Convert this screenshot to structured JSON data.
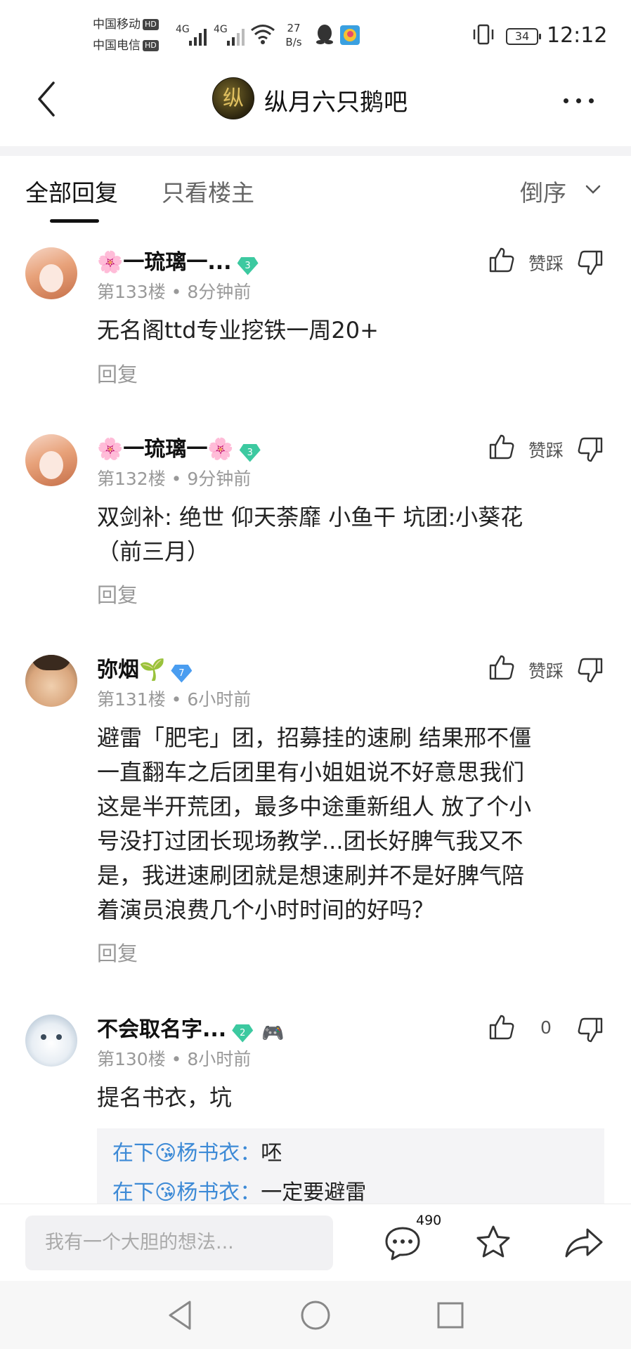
{
  "status_bar": {
    "carrier1": "中国移动",
    "carrier2": "中国电信",
    "hd": "HD",
    "net1": "4G",
    "net2": "4G",
    "speed_value": "27",
    "speed_unit": "B/s",
    "battery": "34",
    "time": "12:12"
  },
  "header": {
    "forum_avatar_text": "纵",
    "title": "纵月六只鹅吧"
  },
  "tabs": {
    "all_replies": "全部回复",
    "owner_only": "只看楼主",
    "sort": "倒序"
  },
  "posts": [
    {
      "username": "🌸一琉璃一...",
      "level": "3",
      "level_color": "#3cc9a0",
      "floor": "第133楼",
      "time": "8分钟前",
      "content_lines": [
        "无名阁ttd专业挖铁一周20+"
      ],
      "vote_label": "赞踩",
      "reply_label": "回复"
    },
    {
      "username": "🌸一琉璃一🌸",
      "level": "3",
      "level_color": "#3cc9a0",
      "floor": "第132楼",
      "time": "9分钟前",
      "content_lines": [
        "双剑补: 绝世 仰天荼靡 小鱼干 坑团:小葵花",
        "（前三月）"
      ],
      "vote_label": "赞踩",
      "reply_label": "回复"
    },
    {
      "username": "弥烟🌱",
      "level": "7",
      "level_color": "#4a9df0",
      "floor": "第131楼",
      "time": "6小时前",
      "content_lines": [
        "避雷「肥宅」团，招募挂的速刷 结果邢不僵",
        "一直翻车之后团里有小姐姐说不好意思我们",
        "这是半开荒团，最多中途重新组人 放了个小",
        "号没打过团长现场教学...团长好脾气我又不",
        "是，我进速刷团就是想速刷并不是好脾气陪",
        "着演员浪费几个小时时间的好吗？"
      ],
      "vote_label": "赞踩",
      "reply_label": "回复"
    },
    {
      "username": "不会取名字...",
      "level": "2",
      "level_color": "#3cc9a0",
      "extra_badge": "🎮",
      "floor": "第130楼",
      "time": "8小时前",
      "content_lines": [
        "提名书衣，坑"
      ],
      "vote_count": "0",
      "sub_replies": [
        {
          "name": "在下😘杨书衣：",
          "text": "呸"
        },
        {
          "name": "在下😘杨书衣：",
          "text": "一定要避雷"
        }
      ]
    }
  ],
  "meta_separator": "•",
  "bottom_bar": {
    "input_placeholder": "我有一个大胆的想法...",
    "comment_count": "490"
  }
}
